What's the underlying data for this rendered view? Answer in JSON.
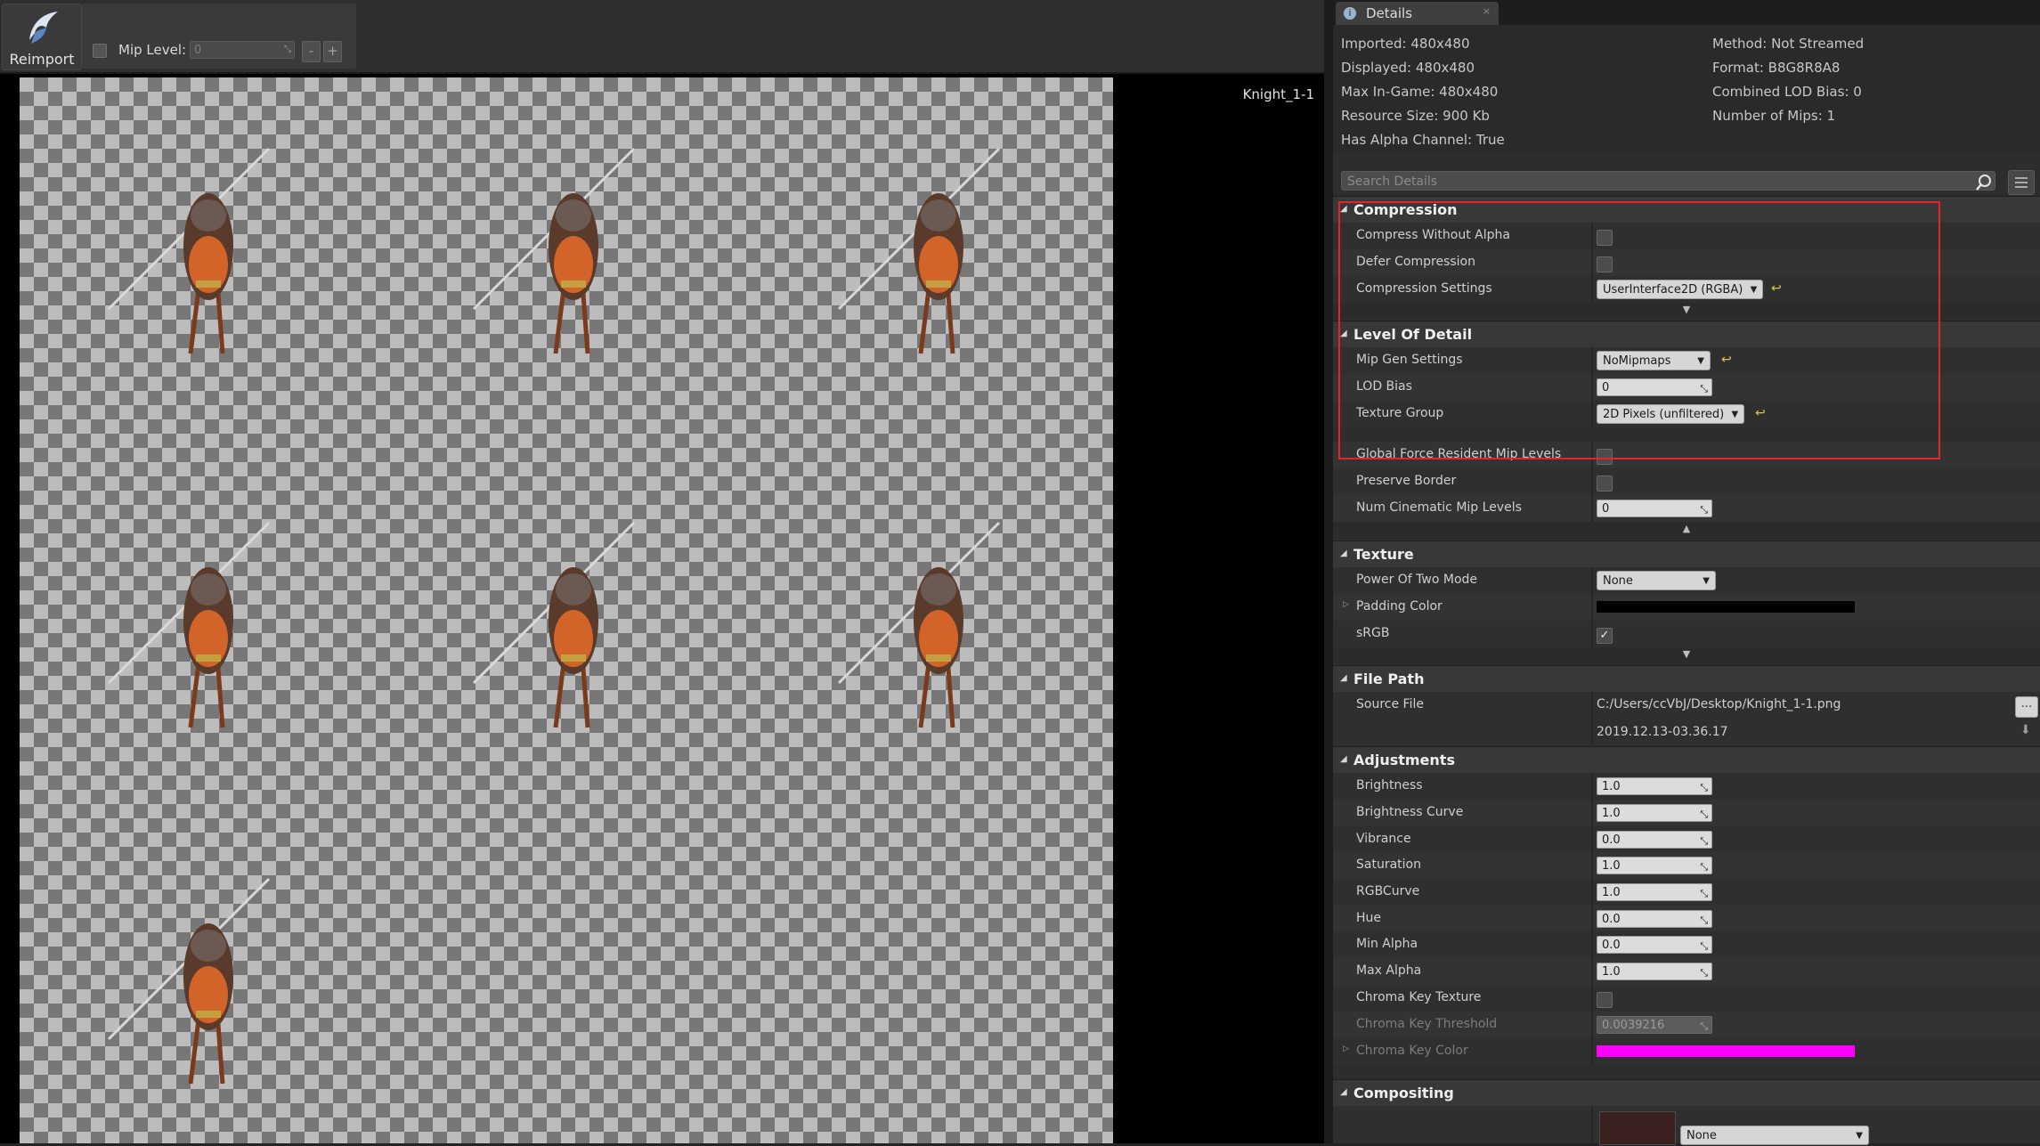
{
  "toolbar": {
    "reimport_label": "Reimport",
    "mip_level_label": "Mip Level:",
    "mip_level_value": "0",
    "minus_label": "-",
    "plus_label": "+"
  },
  "viewport": {
    "texture_name": "Knight_1-1"
  },
  "details": {
    "tab_label": "Details",
    "tab_close": "×",
    "info_left": [
      "Imported: 480x480",
      "Displayed: 480x480",
      "Max In-Game: 480x480",
      "Resource Size: 900 Kb",
      "Has Alpha Channel: True"
    ],
    "info_right": [
      "Method: Not Streamed",
      "Format: B8G8R8A8",
      "Combined LOD Bias: 0",
      "Number of Mips: 1"
    ],
    "search_placeholder": "Search Details",
    "compression": {
      "title": "Compression",
      "compress_without_alpha": "Compress Without Alpha",
      "defer_compression": "Defer Compression",
      "compression_settings": "Compression Settings",
      "compression_settings_value": "UserInterface2D (RGBA)"
    },
    "lod": {
      "title": "Level Of Detail",
      "mip_gen_settings": "Mip Gen Settings",
      "mip_gen_value": "NoMipmaps",
      "lod_bias": "LOD Bias",
      "lod_bias_value": "0",
      "texture_group": "Texture Group",
      "texture_group_value": "2D Pixels (unfiltered)",
      "global_force_resident": "Global Force Resident Mip Levels",
      "preserve_border": "Preserve Border",
      "num_cinematic_mips": "Num Cinematic Mip Levels",
      "num_cinematic_mips_value": "0"
    },
    "texture": {
      "title": "Texture",
      "power_of_two_mode": "Power Of Two Mode",
      "power_of_two_value": "None",
      "padding_color": "Padding Color",
      "padding_color_hex": "#000000",
      "srgb": "sRGB",
      "srgb_checked": "✓"
    },
    "file_path": {
      "title": "File Path",
      "source_file": "Source File",
      "source_file_value": "C:/Users/ccVbJ/Desktop/Knight_1-1.png",
      "timestamp": "2019.12.13-03.36.17",
      "browse_label": "..."
    },
    "adjustments": {
      "title": "Adjustments",
      "rows": [
        {
          "label": "Brightness",
          "value": "1.0"
        },
        {
          "label": "Brightness Curve",
          "value": "1.0"
        },
        {
          "label": "Vibrance",
          "value": "0.0"
        },
        {
          "label": "Saturation",
          "value": "1.0"
        },
        {
          "label": "RGBCurve",
          "value": "1.0"
        },
        {
          "label": "Hue",
          "value": "0.0"
        },
        {
          "label": "Min Alpha",
          "value": "0.0"
        },
        {
          "label": "Max Alpha",
          "value": "1.0"
        }
      ],
      "chroma_key_texture": "Chroma Key Texture",
      "chroma_key_threshold": "Chroma Key Threshold",
      "chroma_key_threshold_value": "0.0039216",
      "chroma_key_color": "Chroma Key Color",
      "chroma_key_color_hex": "#ff00ff"
    },
    "compositing": {
      "title": "Compositing",
      "texture_value": "None"
    }
  },
  "colors": {
    "highlight": "#e8222a",
    "reset_arrow": "#d8c64b"
  }
}
